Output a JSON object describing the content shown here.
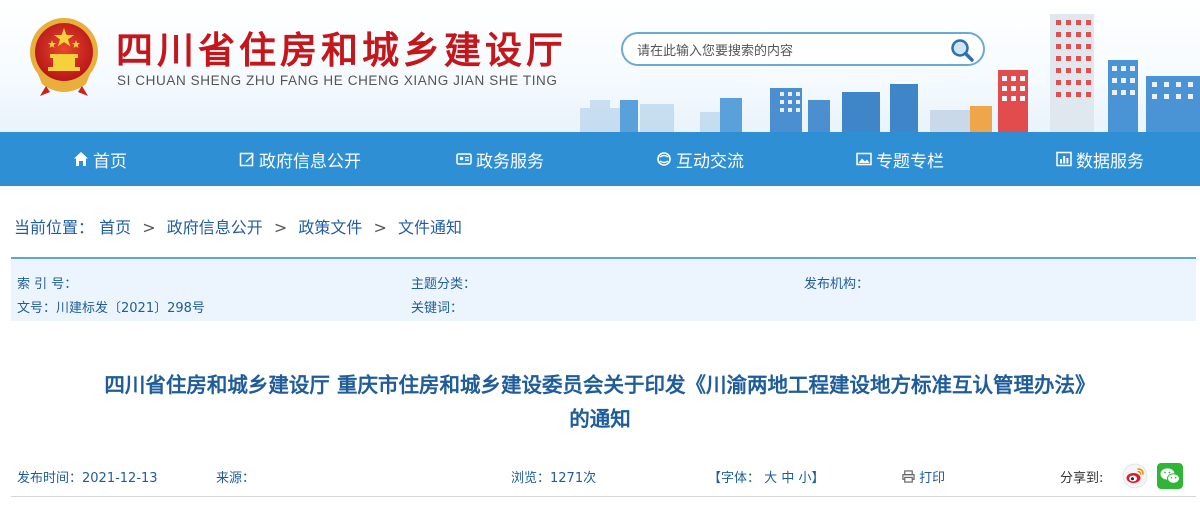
{
  "header": {
    "title": "四川省住房和城乡建设厅",
    "subtitle": "SI CHUAN SHENG ZHU FANG HE CHENG XIANG JIAN SHE TING",
    "emblem_icon": "national-emblem-icon"
  },
  "search": {
    "placeholder": "请在此输入您要搜索的内容",
    "icon": "search-icon"
  },
  "nav": {
    "items": [
      {
        "label": "首页",
        "icon": "home-icon"
      },
      {
        "label": "政府信息公开",
        "icon": "edit-icon"
      },
      {
        "label": "政务服务",
        "icon": "id-card-icon"
      },
      {
        "label": "互动交流",
        "icon": "chat-icon"
      },
      {
        "label": "专题专栏",
        "icon": "image-icon"
      },
      {
        "label": "数据服务",
        "icon": "bar-chart-icon"
      }
    ]
  },
  "breadcrumb": {
    "label": "当前位置：",
    "items": [
      "首页",
      "政府信息公开",
      "政策文件",
      "文件通知"
    ],
    "separator": ">"
  },
  "meta": {
    "index_label": "索 引 号：",
    "topic_label": "主题分类：",
    "publisher_label": "发布机构：",
    "doc_no_label": "文号：",
    "doc_no_value": "川建标发〔2021〕298号",
    "keywords_label": "关键词："
  },
  "article": {
    "title_line1": "四川省住房和城乡建设厅 重庆市住房和城乡建设委员会关于印发《川渝两地工程建设地方标准互认管理办法》",
    "title_line2": "的通知"
  },
  "info": {
    "date_label": "发布时间：",
    "date_value": "2021-12-13",
    "source_label": "来源：",
    "views_label": "浏览：",
    "views_value": "1271次",
    "font_label": "【字体：",
    "font_large": "大",
    "font_medium": "中",
    "font_small": "小",
    "font_close": "】",
    "print_label": "打印",
    "share_label": "分享到:"
  },
  "colors": {
    "title_red": "#c3171c",
    "nav_blue": "#2f8fd5",
    "text_blue": "#1f5c9a",
    "meta_bg": "#ecf5fd"
  }
}
